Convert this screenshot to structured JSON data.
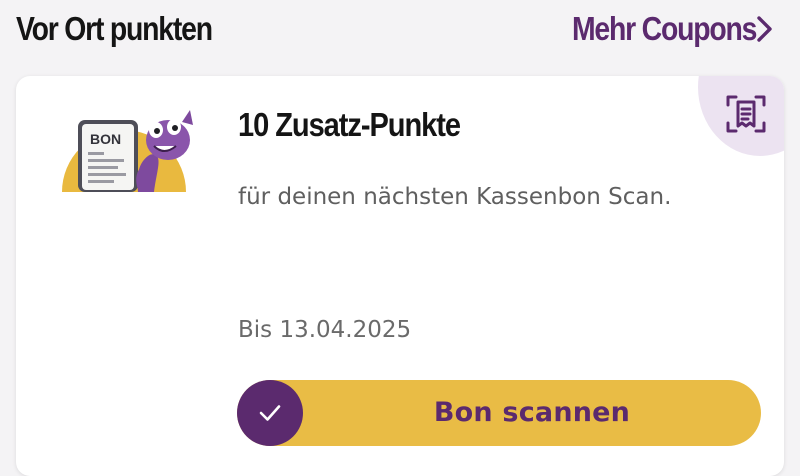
{
  "section": {
    "title": "Vor Ort punkten",
    "more_link": "Mehr Coupons",
    "more_icon": "chevron-right-icon"
  },
  "coupon": {
    "title": "10 Zusatz-Punkte",
    "description": "für deinen nächsten Kassenbon Scan.",
    "validity": "Bis 13.04.2025",
    "illustration_text": "BON",
    "scan_icon": "receipt-scan-icon",
    "button": {
      "label": "Bon scannen",
      "icon": "check-icon"
    }
  },
  "colors": {
    "brand_purple": "#5b2a6e",
    "accent_yellow": "#e9bc45",
    "scan_badge_bg": "#ece3f1",
    "background": "#f4f3f5"
  }
}
